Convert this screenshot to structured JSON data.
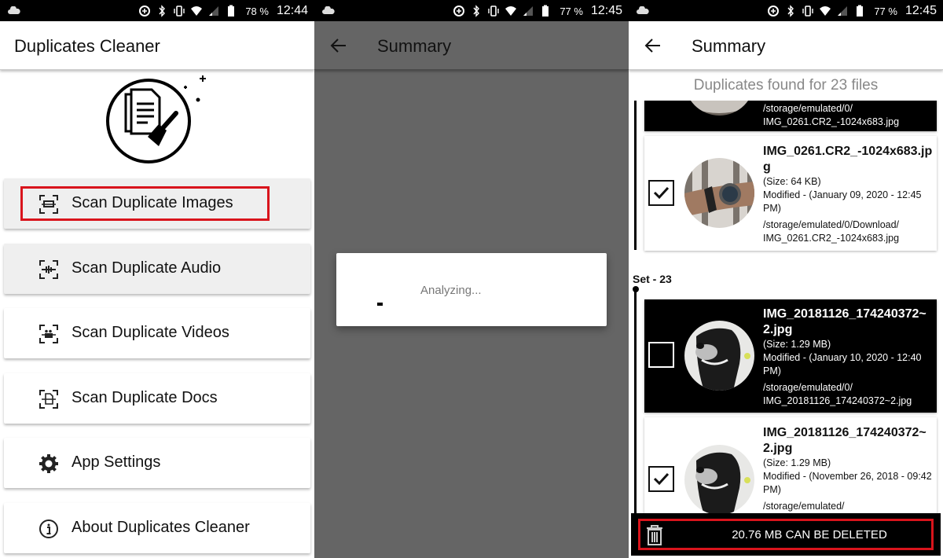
{
  "screens": [
    {
      "status": {
        "battery": "78 %",
        "time": "12:44"
      },
      "app_title": "Duplicates Cleaner",
      "menu": [
        {
          "label": "Scan Duplicate Images",
          "icon": "scan-image-icon"
        },
        {
          "label": "Scan Duplicate Audio",
          "icon": "scan-audio-icon"
        },
        {
          "label": "Scan Duplicate Videos",
          "icon": "scan-video-icon"
        },
        {
          "label": "Scan Duplicate Docs",
          "icon": "scan-docs-icon"
        },
        {
          "label": "App Settings",
          "icon": "gear-icon"
        },
        {
          "label": "About Duplicates Cleaner",
          "icon": "info-icon"
        }
      ]
    },
    {
      "status": {
        "battery": "77 %",
        "time": "12:45"
      },
      "title": "Summary",
      "dialog_text": "Analyzing..."
    },
    {
      "status": {
        "battery": "77 %",
        "time": "12:45"
      },
      "title": "Summary",
      "found_text": "Duplicates found for 23 files",
      "partial_card": {
        "path": "/storage/emulated/0/ IMG_0261.CR2_-1024x683.jpg"
      },
      "cards": [
        {
          "name": "IMG_0261.CR2_-1024x683.jpg",
          "size": "(Size: 64 KB)",
          "modified": "Modified - (January 09, 2020 - 12:45 PM)",
          "path": "/storage/emulated/0/Download/ IMG_0261.CR2_-1024x683.jpg",
          "checked": true,
          "thumb": "watch-photo"
        },
        {
          "name": "IMG_20181126_174240372~2.jpg",
          "size": "(Size: 1.29 MB)",
          "modified": "Modified - (January 10, 2020 - 12:40 PM)",
          "path": "/storage/emulated/0/ IMG_20181126_174240372~2.jpg",
          "checked": false,
          "thumb": "dog-photo"
        },
        {
          "name": "IMG_20181126_174240372~2.jpg",
          "size": "(Size: 1.29 MB)",
          "modified": "Modified - (November 26, 2018 - 09:42 PM)",
          "path": "/storage/emulated/",
          "checked": true,
          "thumb": "dog-photo"
        }
      ],
      "set_label": "Set - 23",
      "delete_label": "20.76 MB CAN BE DELETED"
    }
  ],
  "colors": {
    "highlight": "#d9141c",
    "dim_overlay": "#656565"
  }
}
